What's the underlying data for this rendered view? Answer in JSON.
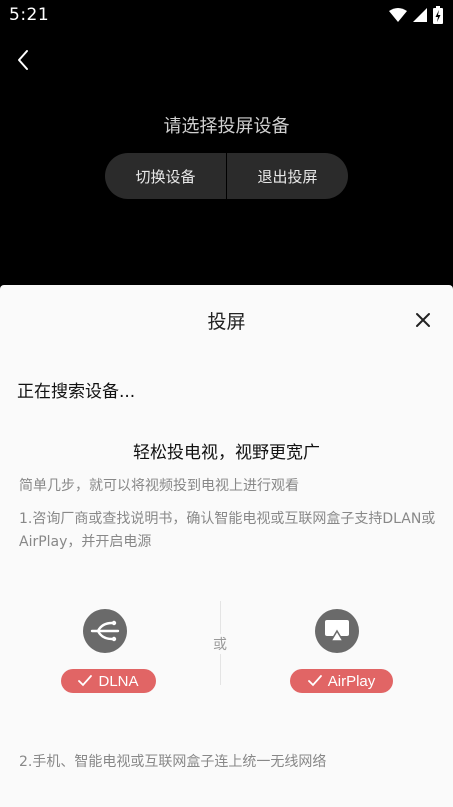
{
  "status_bar": {
    "time": "5:21",
    "icons": [
      "wifi-icon",
      "signal-icon",
      "battery-charging-icon"
    ]
  },
  "top": {
    "back_icon": "chevron-left-icon",
    "title": "请选择投屏设备",
    "switch_label": "切换设备",
    "exit_label": "退出投屏"
  },
  "sheet": {
    "title": "投屏",
    "close_icon": "close-icon",
    "searching": "正在搜索设备...",
    "guide_heading": "轻松投电视，视野更宽广",
    "guide_sub": "简单几步，就可以将视频投到电视上进行观看",
    "step1": "1.咨询厂商或查找说明书，确认智能电视或互联网盒子支持DLAN或AirPlay，并开启电源",
    "protocols": [
      {
        "name": "DLNA",
        "icon": "dlna-icon"
      },
      {
        "name": "AirPlay",
        "icon": "airplay-icon"
      }
    ],
    "or_text": "或",
    "step2": "2.手机、智能电视或互联网盒子连上统一无线网络"
  },
  "colors": {
    "badge": "#e16565",
    "icon_bg": "#6a6a6a",
    "sheet_bg": "#fafafa"
  }
}
